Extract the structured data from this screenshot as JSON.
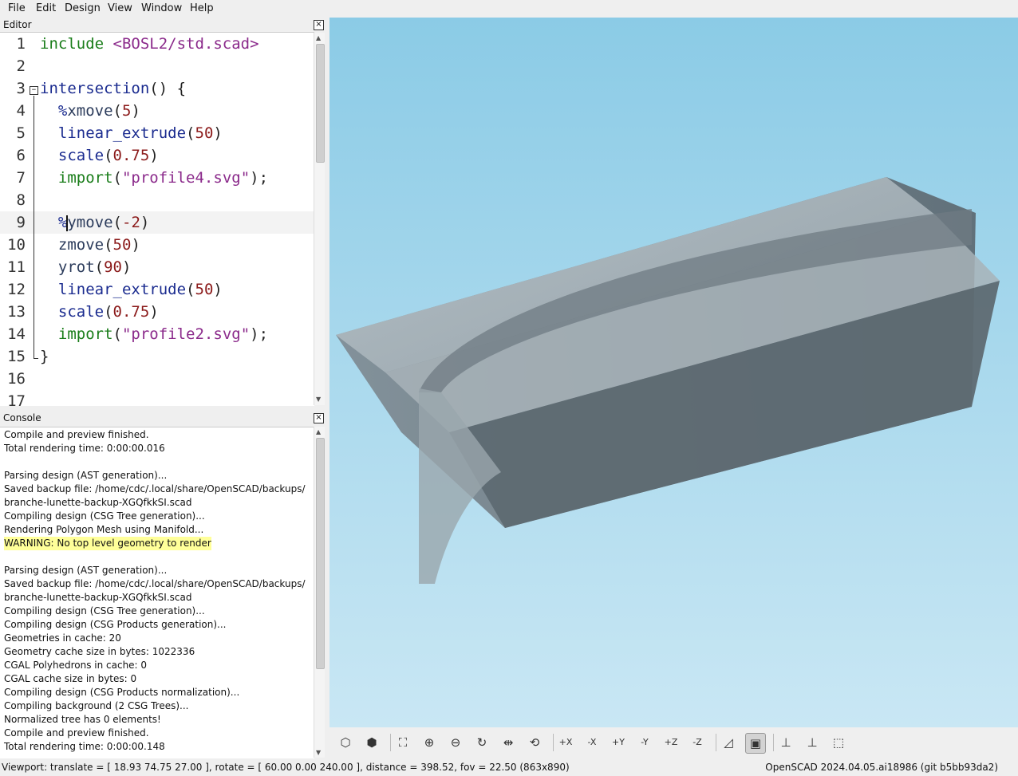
{
  "menubar": [
    "File",
    "Edit",
    "Design",
    "View",
    "Window",
    "Help"
  ],
  "editor": {
    "title": "Editor",
    "lines": [
      {
        "n": "1",
        "tokens": [
          {
            "t": "include ",
            "c": "k-green"
          },
          {
            "t": "<BOSL2/std.scad>",
            "c": "k-purple"
          }
        ]
      },
      {
        "n": "2",
        "tokens": []
      },
      {
        "n": "3",
        "tokens": [
          {
            "t": "intersection",
            "c": "k-blue"
          },
          {
            "t": "() {",
            "c": "k-plain"
          }
        ]
      },
      {
        "n": "4",
        "tokens": [
          {
            "t": "  ",
            "c": "k-plain"
          },
          {
            "t": "%",
            "c": "k-blue"
          },
          {
            "t": "xmove",
            "c": "k-ident"
          },
          {
            "t": "(",
            "c": "k-plain"
          },
          {
            "t": "5",
            "c": "k-num"
          },
          {
            "t": ")",
            "c": "k-plain"
          }
        ]
      },
      {
        "n": "5",
        "tokens": [
          {
            "t": "  ",
            "c": "k-plain"
          },
          {
            "t": "linear_extrude",
            "c": "k-blue"
          },
          {
            "t": "(",
            "c": "k-plain"
          },
          {
            "t": "50",
            "c": "k-num"
          },
          {
            "t": ")",
            "c": "k-plain"
          }
        ]
      },
      {
        "n": "6",
        "tokens": [
          {
            "t": "  ",
            "c": "k-plain"
          },
          {
            "t": "scale",
            "c": "k-blue"
          },
          {
            "t": "(",
            "c": "k-plain"
          },
          {
            "t": "0.75",
            "c": "k-num"
          },
          {
            "t": ")",
            "c": "k-plain"
          }
        ]
      },
      {
        "n": "7",
        "tokens": [
          {
            "t": "  ",
            "c": "k-plain"
          },
          {
            "t": "import",
            "c": "k-green"
          },
          {
            "t": "(",
            "c": "k-plain"
          },
          {
            "t": "\"profile4.svg\"",
            "c": "k-str"
          },
          {
            "t": ");",
            "c": "k-plain"
          }
        ]
      },
      {
        "n": "8",
        "tokens": []
      },
      {
        "n": "9",
        "tokens": [
          {
            "t": "  ",
            "c": "k-plain"
          },
          {
            "t": "%",
            "c": "k-blue"
          },
          {
            "t": "ymove",
            "c": "k-ident"
          },
          {
            "t": "(",
            "c": "k-plain"
          },
          {
            "t": "-2",
            "c": "k-num"
          },
          {
            "t": ")",
            "c": "k-plain"
          }
        ],
        "current": true
      },
      {
        "n": "10",
        "tokens": [
          {
            "t": "  ",
            "c": "k-plain"
          },
          {
            "t": "zmove",
            "c": "k-ident"
          },
          {
            "t": "(",
            "c": "k-plain"
          },
          {
            "t": "50",
            "c": "k-num"
          },
          {
            "t": ")",
            "c": "k-plain"
          }
        ]
      },
      {
        "n": "11",
        "tokens": [
          {
            "t": "  ",
            "c": "k-plain"
          },
          {
            "t": "yrot",
            "c": "k-ident"
          },
          {
            "t": "(",
            "c": "k-plain"
          },
          {
            "t": "90",
            "c": "k-num"
          },
          {
            "t": ")",
            "c": "k-plain"
          }
        ]
      },
      {
        "n": "12",
        "tokens": [
          {
            "t": "  ",
            "c": "k-plain"
          },
          {
            "t": "linear_extrude",
            "c": "k-blue"
          },
          {
            "t": "(",
            "c": "k-plain"
          },
          {
            "t": "50",
            "c": "k-num"
          },
          {
            "t": ")",
            "c": "k-plain"
          }
        ]
      },
      {
        "n": "13",
        "tokens": [
          {
            "t": "  ",
            "c": "k-plain"
          },
          {
            "t": "scale",
            "c": "k-blue"
          },
          {
            "t": "(",
            "c": "k-plain"
          },
          {
            "t": "0.75",
            "c": "k-num"
          },
          {
            "t": ")",
            "c": "k-plain"
          }
        ]
      },
      {
        "n": "14",
        "tokens": [
          {
            "t": "  ",
            "c": "k-plain"
          },
          {
            "t": "import",
            "c": "k-green"
          },
          {
            "t": "(",
            "c": "k-plain"
          },
          {
            "t": "\"profile2.svg\"",
            "c": "k-str"
          },
          {
            "t": ");",
            "c": "k-plain"
          }
        ]
      },
      {
        "n": "15",
        "tokens": [
          {
            "t": "}",
            "c": "k-plain"
          }
        ]
      },
      {
        "n": "16",
        "tokens": []
      },
      {
        "n": "17",
        "tokens": []
      }
    ]
  },
  "console": {
    "title": "Console",
    "lines": [
      {
        "text": "Compile and preview finished."
      },
      {
        "text": "Total rendering time: 0:00:00.016"
      },
      {
        "text": ""
      },
      {
        "text": "Parsing design (AST generation)..."
      },
      {
        "text": "Saved backup file: /home/cdc/.local/share/OpenSCAD/backups/"
      },
      {
        "text": "branche-lunette-backup-XGQfkkSI.scad"
      },
      {
        "text": "Compiling design (CSG Tree generation)..."
      },
      {
        "text": "Rendering Polygon Mesh using Manifold..."
      },
      {
        "text": "WARNING: No top level geometry to render",
        "warning": true
      },
      {
        "text": ""
      },
      {
        "text": "Parsing design (AST generation)..."
      },
      {
        "text": "Saved backup file: /home/cdc/.local/share/OpenSCAD/backups/"
      },
      {
        "text": "branche-lunette-backup-XGQfkkSI.scad"
      },
      {
        "text": "Compiling design (CSG Tree generation)..."
      },
      {
        "text": "Compiling design (CSG Products generation)..."
      },
      {
        "text": "Geometries in cache: 20"
      },
      {
        "text": "Geometry cache size in bytes: 1022336"
      },
      {
        "text": "CGAL Polyhedrons in cache: 0"
      },
      {
        "text": "CGAL cache size in bytes: 0"
      },
      {
        "text": "Compiling design (CSG Products normalization)..."
      },
      {
        "text": "Compiling background (2 CSG Trees)..."
      },
      {
        "text": "Normalized tree has 0 elements!"
      },
      {
        "text": "Compile and preview finished."
      },
      {
        "text": "Total rendering time: 0:00:00.148"
      }
    ]
  },
  "toolbar": [
    {
      "name": "preview-icon",
      "glyph": "⬡"
    },
    {
      "name": "render-icon",
      "glyph": "⬢"
    },
    {
      "name": "sep"
    },
    {
      "name": "view-all-icon",
      "glyph": "⛶"
    },
    {
      "name": "zoom-in-icon",
      "glyph": "⊕"
    },
    {
      "name": "zoom-out-icon",
      "glyph": "⊖"
    },
    {
      "name": "reset-view-icon",
      "glyph": "↻"
    },
    {
      "name": "view-center-icon",
      "glyph": "⇹"
    },
    {
      "name": "rotate-icon",
      "glyph": "⟲"
    },
    {
      "name": "sep"
    },
    {
      "name": "view-right-icon",
      "glyph": "+X"
    },
    {
      "name": "view-left-icon",
      "glyph": "-X"
    },
    {
      "name": "view-back-icon",
      "glyph": "+Y"
    },
    {
      "name": "view-front-icon",
      "glyph": "-Y"
    },
    {
      "name": "view-top-icon",
      "glyph": "+Z"
    },
    {
      "name": "view-bottom-icon",
      "glyph": "-Z"
    },
    {
      "name": "sep"
    },
    {
      "name": "perspective-icon",
      "glyph": "◿"
    },
    {
      "name": "orthogonal-icon",
      "glyph": "▣",
      "active": true
    },
    {
      "name": "sep"
    },
    {
      "name": "show-axes-icon",
      "glyph": "⊥"
    },
    {
      "name": "show-scale-markers-icon",
      "glyph": "⊥"
    },
    {
      "name": "show-edges-icon",
      "glyph": "⬚"
    }
  ],
  "status": {
    "viewport": "Viewport: translate = [ 18.93 74.75 27.00 ], rotate = [ 60.00 0.00 240.00 ], distance = 398.52, fov = 22.50 (863x890)",
    "version": "OpenSCAD 2024.04.05.ai18986 (git b5bb93da2)"
  }
}
